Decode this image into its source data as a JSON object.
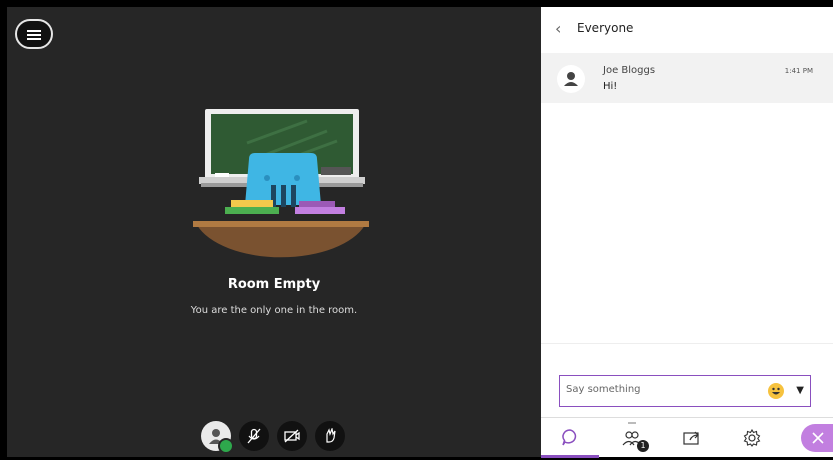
{
  "stage": {
    "menu_icon": "hamburger-icon",
    "room_title": "Room Empty",
    "room_subtitle": "You are the only one in the room.",
    "controls": [
      {
        "icon": "user-avatar-icon",
        "status": "connected"
      },
      {
        "icon": "microphone-muted-icon"
      },
      {
        "icon": "camera-off-icon"
      },
      {
        "icon": "hand-raise-icon"
      }
    ]
  },
  "chat": {
    "back_icon": "chevron-left-icon",
    "title": "Everyone",
    "messages": [
      {
        "sender": "Joe Bloggs",
        "text": "Hi!",
        "time": "1:41 PM"
      }
    ],
    "input": {
      "placeholder": "Say something",
      "value": ""
    },
    "emoji_icon": "smile-emoji-icon",
    "dropdown_icon": "caret-down-icon"
  },
  "tabs": [
    {
      "name": "chat",
      "icon": "chat-bubble-icon",
      "active": true
    },
    {
      "name": "attendees",
      "icon": "attendees-icon",
      "badge": "1"
    },
    {
      "name": "share",
      "icon": "share-content-icon"
    },
    {
      "name": "settings",
      "icon": "gear-icon"
    },
    {
      "name": "close",
      "icon": "close-icon"
    }
  ],
  "colors": {
    "accent": "#8a4fbf",
    "close_tab": "#c27fe0",
    "stage_bg": "#262626",
    "status_ok": "#2ea84c"
  }
}
